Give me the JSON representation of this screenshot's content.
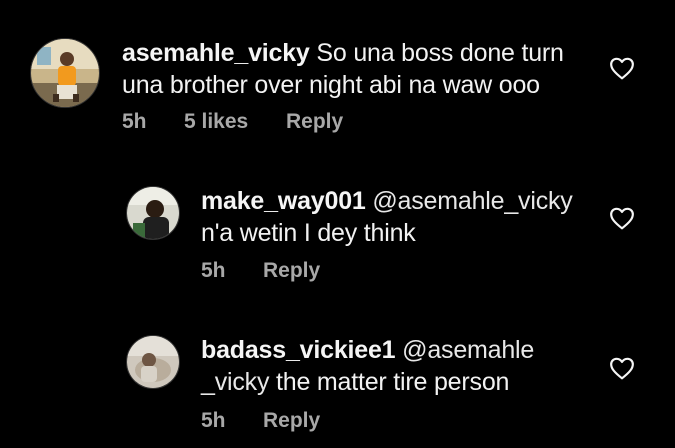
{
  "comments": [
    {
      "username": "asemahle_vicky",
      "text_line1": "So una boss done turn",
      "text_line2": "una brother over night abi na waw ooo",
      "time": "5h",
      "likes": "5 likes",
      "reply": "Reply"
    },
    {
      "username": "make_way001",
      "mention": "@asemahle_vicky",
      "text_line2": "n'a wetin I dey think",
      "time": "5h",
      "reply": "Reply"
    },
    {
      "username": "badass_vickiee1",
      "mention": "@asemahle",
      "text_line2_mention": "_vicky",
      "text_line2": " the matter tire person",
      "time": "5h",
      "reply": "Reply"
    }
  ],
  "icons": {
    "like": "heart-outline-icon",
    "avatar": "profile-photo"
  },
  "colors": {
    "background": "#000000",
    "text": "#f5f5f5",
    "meta": "#a8a8a8"
  }
}
